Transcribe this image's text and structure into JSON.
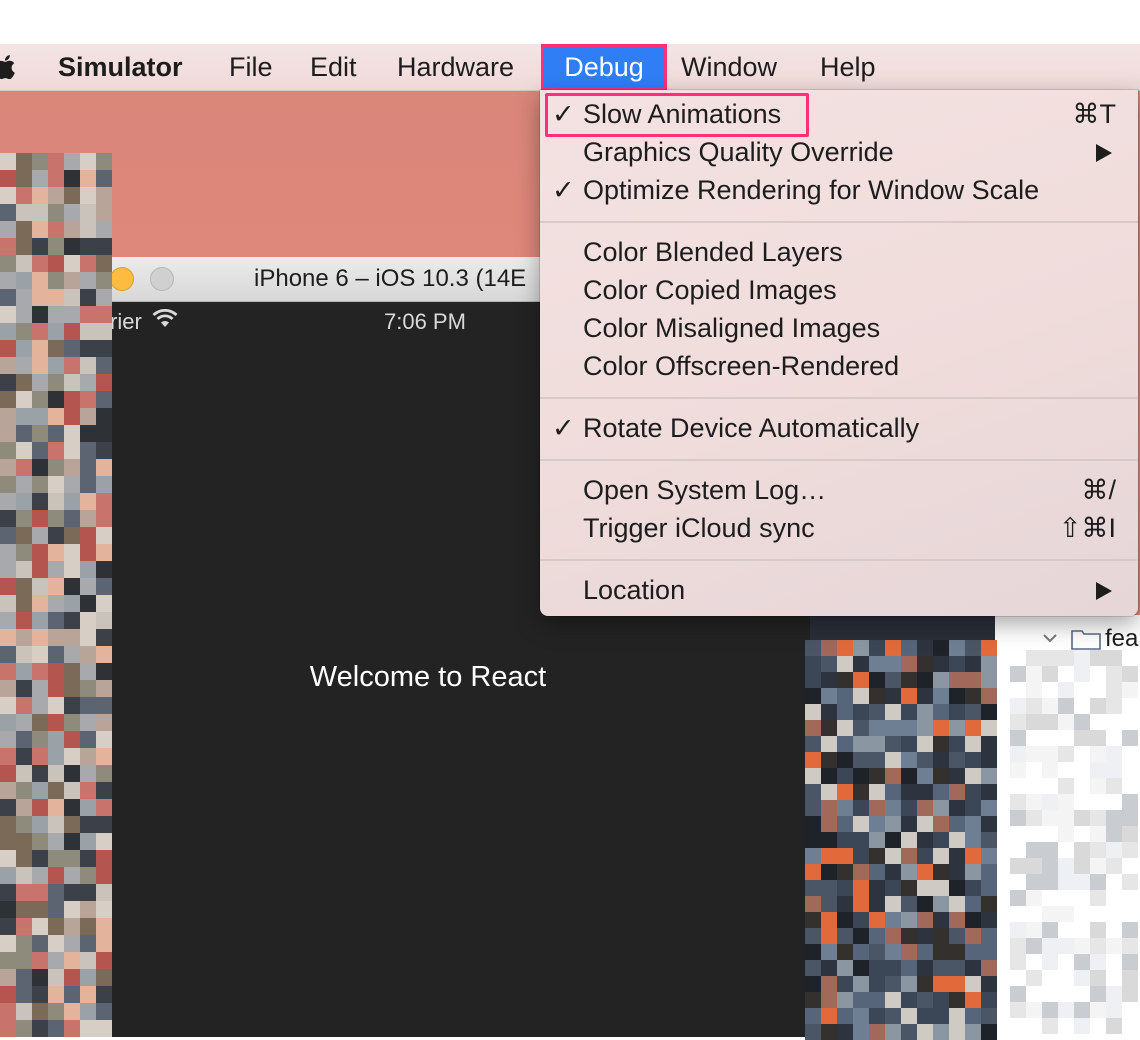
{
  "menubar": {
    "app_name": "Simulator",
    "items": [
      "File",
      "Edit",
      "Hardware",
      "Debug",
      "Window",
      "Help"
    ],
    "active_item": "Debug"
  },
  "simulator_window": {
    "title": "iPhone 6 – iOS 10.3 (14E",
    "status_carrier": "rier",
    "status_time": "7:06 PM",
    "content_text": "Welcome to React"
  },
  "right_panel": {
    "folder_label": "fea"
  },
  "debug_menu": {
    "slow_animations": {
      "label": "Slow Animations",
      "check": "✓",
      "shortcut": "⌘T"
    },
    "graphics_quality": {
      "label": "Graphics Quality Override"
    },
    "optimize_rendering": {
      "label": "Optimize Rendering for Window Scale",
      "check": "✓"
    },
    "color_blended": {
      "label": "Color Blended Layers"
    },
    "color_copied": {
      "label": "Color Copied Images"
    },
    "color_misaligned": {
      "label": "Color Misaligned Images"
    },
    "color_offscreen": {
      "label": "Color Offscreen-Rendered"
    },
    "rotate_device": {
      "label": "Rotate Device Automatically",
      "check": "✓"
    },
    "open_system_log": {
      "label": "Open System Log…",
      "shortcut": "⌘/"
    },
    "trigger_icloud": {
      "label": "Trigger iCloud sync",
      "shortcut": "⇧⌘I"
    },
    "location": {
      "label": "Location"
    }
  },
  "colors": {
    "accent": "#2f7ef6",
    "highlight": "#ff2f7a"
  }
}
